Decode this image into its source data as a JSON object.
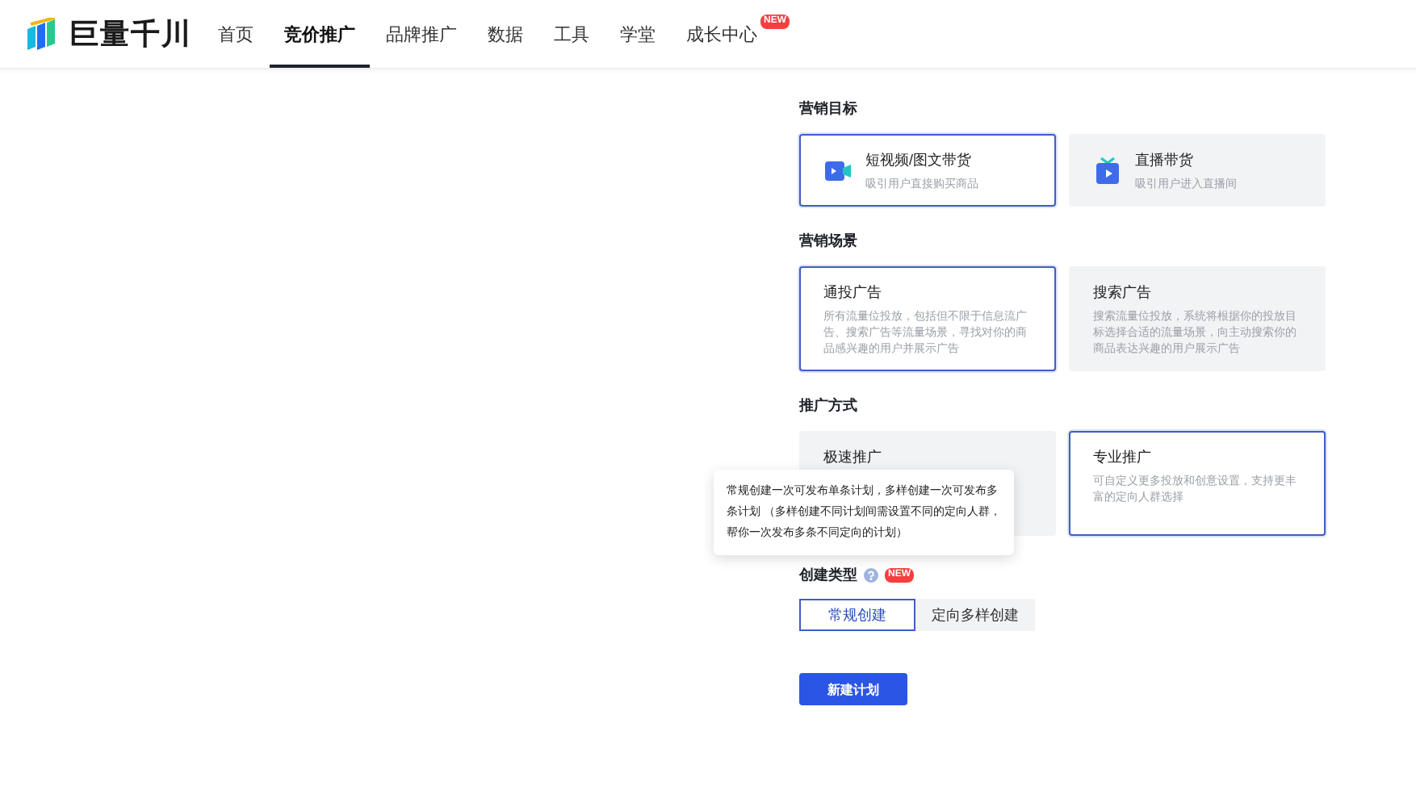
{
  "brand": {
    "name": "巨量千川"
  },
  "nav": [
    {
      "label": "首页",
      "selected": false
    },
    {
      "label": "竞价推广",
      "selected": true
    },
    {
      "label": "品牌推广",
      "selected": false
    },
    {
      "label": "数据",
      "selected": false
    },
    {
      "label": "工具",
      "selected": false
    },
    {
      "label": "学堂",
      "selected": false
    },
    {
      "label": "成长中心",
      "selected": false,
      "badge": "NEW"
    }
  ],
  "sections": [
    {
      "title": "营销目标",
      "options": [
        {
          "kind": "video",
          "title": "短视频/图文带货",
          "desc": "吸引用户直接购买商品",
          "selected": true
        },
        {
          "kind": "live",
          "title": "直播带货",
          "desc": "吸引用户进入直播间",
          "selected": false
        }
      ]
    },
    {
      "title": "营销场景",
      "options": [
        {
          "kind": "text",
          "title": "通投广告",
          "desc": "所有流量位投放，包括但不限于信息流广告、搜索广告等流量场景，寻找对你的商品感兴趣的用户并展示广告",
          "selected": true
        },
        {
          "kind": "text",
          "title": "搜索广告",
          "desc": "搜索流量位投放，系统将根据你的投放目标选择合适的流量场景，向主动搜索你的商品表达兴趣的用户展示广告",
          "selected": false
        }
      ]
    },
    {
      "title": "推广方式",
      "options": [
        {
          "kind": "text",
          "title": "极速推广",
          "selected": false
        },
        {
          "kind": "text",
          "title": "专业推广",
          "desc": "可自定义更多投放和创意设置，支持更丰富的定向人群选择",
          "selected": true
        }
      ]
    }
  ],
  "create_type": {
    "label": "创建类型",
    "badge": "NEW",
    "options": [
      {
        "label": "常规创建",
        "selected": true
      },
      {
        "label": "定向多样创建",
        "selected": false
      }
    ]
  },
  "tooltip": "常规创建一次可发布单条计划，多样创建一次可发布多条计划 （多样创建不同计划间需设置不同的定向人群，帮你一次发布多条不同定向的计划）",
  "submit": "新建计划"
}
